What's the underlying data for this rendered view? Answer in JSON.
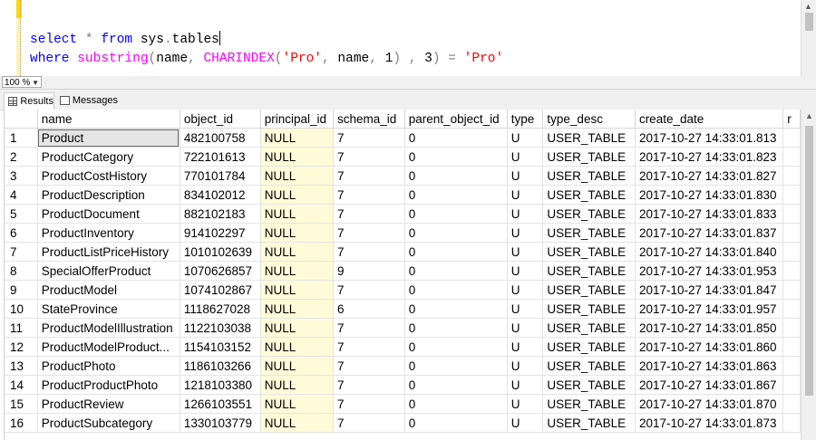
{
  "editor": {
    "lines": [
      [
        {
          "t": "select",
          "c": "kw"
        },
        {
          "t": " ",
          "c": "pl"
        },
        {
          "t": "*",
          "c": "op"
        },
        {
          "t": " ",
          "c": "pl"
        },
        {
          "t": "from",
          "c": "kw"
        },
        {
          "t": " ",
          "c": "pl"
        },
        {
          "t": "sys",
          "c": "pl"
        },
        {
          "t": ".",
          "c": "op"
        },
        {
          "t": "tables",
          "c": "pl"
        }
      ],
      [
        {
          "t": "where",
          "c": "kw"
        },
        {
          "t": " ",
          "c": "pl"
        },
        {
          "t": "substring",
          "c": "fn"
        },
        {
          "t": "(",
          "c": "op"
        },
        {
          "t": "name",
          "c": "pl"
        },
        {
          "t": ",",
          "c": "op"
        },
        {
          "t": " ",
          "c": "pl"
        },
        {
          "t": "CHARINDEX",
          "c": "fn"
        },
        {
          "t": "(",
          "c": "op"
        },
        {
          "t": "'Pro'",
          "c": "str"
        },
        {
          "t": ",",
          "c": "op"
        },
        {
          "t": " ",
          "c": "pl"
        },
        {
          "t": "name",
          "c": "pl"
        },
        {
          "t": ",",
          "c": "op"
        },
        {
          "t": " ",
          "c": "pl"
        },
        {
          "t": "1",
          "c": "pl"
        },
        {
          "t": ")",
          "c": "op"
        },
        {
          "t": " ",
          "c": "pl"
        },
        {
          "t": ",",
          "c": "op"
        },
        {
          "t": " ",
          "c": "pl"
        },
        {
          "t": "3",
          "c": "pl"
        },
        {
          "t": ")",
          "c": "op"
        },
        {
          "t": " ",
          "c": "pl"
        },
        {
          "t": "=",
          "c": "op"
        },
        {
          "t": " ",
          "c": "pl"
        },
        {
          "t": "'Pro'",
          "c": "str"
        }
      ]
    ]
  },
  "zoom": {
    "value": "100 %"
  },
  "tabs": [
    {
      "label": "Results",
      "icon": "results-grid-icon",
      "active": true
    },
    {
      "label": "Messages",
      "icon": "messages-icon",
      "active": false
    }
  ],
  "grid": {
    "columns": [
      "",
      "name",
      "object_id",
      "principal_id",
      "schema_id",
      "parent_object_id",
      "type",
      "type_desc",
      "create_date",
      "r"
    ],
    "rows": [
      [
        "1",
        "Product",
        "482100758",
        "NULL",
        "7",
        "0",
        "U",
        "USER_TABLE",
        "2017-10-27 14:33:01.813",
        ""
      ],
      [
        "2",
        "ProductCategory",
        "722101613",
        "NULL",
        "7",
        "0",
        "U",
        "USER_TABLE",
        "2017-10-27 14:33:01.823",
        ""
      ],
      [
        "3",
        "ProductCostHistory",
        "770101784",
        "NULL",
        "7",
        "0",
        "U",
        "USER_TABLE",
        "2017-10-27 14:33:01.827",
        ""
      ],
      [
        "4",
        "ProductDescription",
        "834102012",
        "NULL",
        "7",
        "0",
        "U",
        "USER_TABLE",
        "2017-10-27 14:33:01.830",
        ""
      ],
      [
        "5",
        "ProductDocument",
        "882102183",
        "NULL",
        "7",
        "0",
        "U",
        "USER_TABLE",
        "2017-10-27 14:33:01.833",
        ""
      ],
      [
        "6",
        "ProductInventory",
        "914102297",
        "NULL",
        "7",
        "0",
        "U",
        "USER_TABLE",
        "2017-10-27 14:33:01.837",
        ""
      ],
      [
        "7",
        "ProductListPriceHistory",
        "1010102639",
        "NULL",
        "7",
        "0",
        "U",
        "USER_TABLE",
        "2017-10-27 14:33:01.840",
        ""
      ],
      [
        "8",
        "SpecialOfferProduct",
        "1070626857",
        "NULL",
        "9",
        "0",
        "U",
        "USER_TABLE",
        "2017-10-27 14:33:01.953",
        ""
      ],
      [
        "9",
        "ProductModel",
        "1074102867",
        "NULL",
        "7",
        "0",
        "U",
        "USER_TABLE",
        "2017-10-27 14:33:01.847",
        ""
      ],
      [
        "10",
        "StateProvince",
        "1118627028",
        "NULL",
        "6",
        "0",
        "U",
        "USER_TABLE",
        "2017-10-27 14:33:01.957",
        ""
      ],
      [
        "11",
        "ProductModelIllustration",
        "1122103038",
        "NULL",
        "7",
        "0",
        "U",
        "USER_TABLE",
        "2017-10-27 14:33:01.850",
        ""
      ],
      [
        "12",
        "ProductModelProduct...",
        "1154103152",
        "NULL",
        "7",
        "0",
        "U",
        "USER_TABLE",
        "2017-10-27 14:33:01.860",
        ""
      ],
      [
        "13",
        "ProductPhoto",
        "1186103266",
        "NULL",
        "7",
        "0",
        "U",
        "USER_TABLE",
        "2017-10-27 14:33:01.863",
        ""
      ],
      [
        "14",
        "ProductProductPhoto",
        "1218103380",
        "NULL",
        "7",
        "0",
        "U",
        "USER_TABLE",
        "2017-10-27 14:33:01.867",
        ""
      ],
      [
        "15",
        "ProductReview",
        "1266103551",
        "NULL",
        "7",
        "0",
        "U",
        "USER_TABLE",
        "2017-10-27 14:33:01.870",
        ""
      ],
      [
        "16",
        "ProductSubcategory",
        "1330103779",
        "NULL",
        "7",
        "0",
        "U",
        "USER_TABLE",
        "2017-10-27 14:33:01.873",
        ""
      ]
    ],
    "selected_row": 0
  },
  "colors": {
    "null_cell": "#fffbd8",
    "keyword": "#0000ff",
    "function": "#ff00ff",
    "string": "#ff0000",
    "operator": "#808080"
  }
}
